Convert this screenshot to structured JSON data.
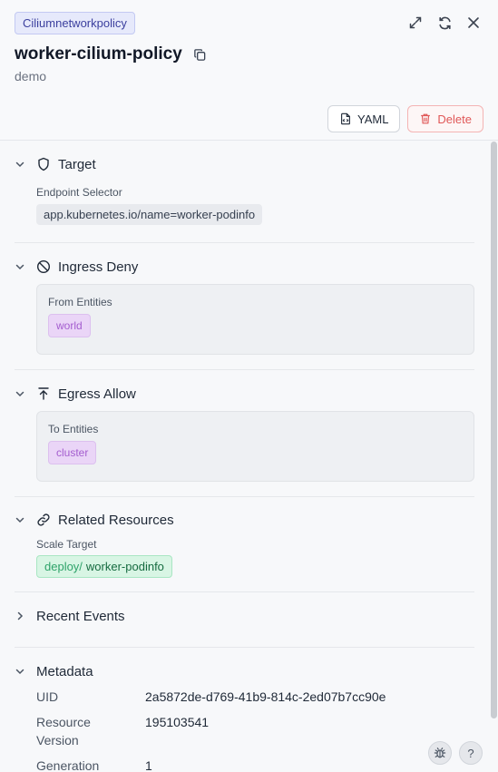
{
  "header": {
    "kind": "Ciliumnetworkpolicy",
    "title": "worker-cilium-policy",
    "namespace": "demo",
    "yaml_label": "YAML",
    "delete_label": "Delete"
  },
  "sections": {
    "target": {
      "title": "Target",
      "label": "Endpoint Selector",
      "selector": "app.kubernetes.io/name=worker-podinfo"
    },
    "ingress": {
      "title": "Ingress Deny",
      "label": "From Entities",
      "entity": "world"
    },
    "egress": {
      "title": "Egress Allow",
      "label": "To Entities",
      "entity": "cluster"
    },
    "related": {
      "title": "Related Resources",
      "label": "Scale Target",
      "prefix": "deploy/",
      "name": "worker-podinfo"
    },
    "events": {
      "title": "Recent Events"
    },
    "metadata": {
      "title": "Metadata",
      "uid_key": "UID",
      "uid_val": "2a5872de-d769-41b9-814c-2ed07b7cc90e",
      "rv_key": "Resource Version",
      "rv_val": "195103541",
      "gen_key": "Generation",
      "gen_val": "1"
    }
  },
  "floating": {
    "help": "?"
  },
  "colors": {
    "accent_badge": "#e6e9fb",
    "delete": "#e05757",
    "entity_chip": "#ead5f7",
    "resource_chip": "#d8f5e4"
  }
}
